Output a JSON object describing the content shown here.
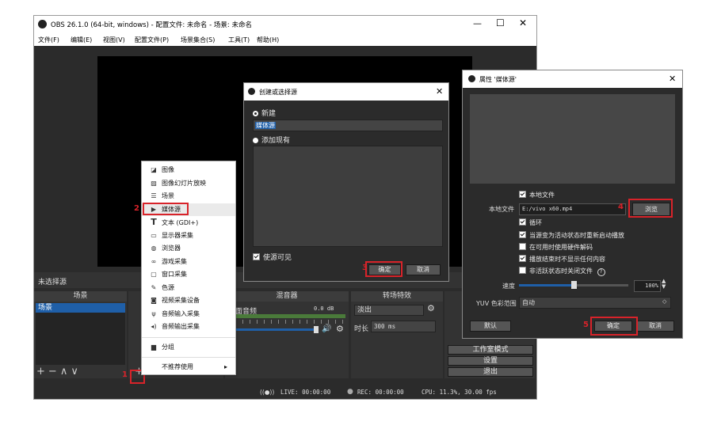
{
  "obs": {
    "title": "OBS 26.1.0 (64-bit, windows) - 配置文件: 未命名 - 场景: 未命名",
    "menu": [
      "文件(F)",
      "编辑(E)",
      "视图(V)",
      "配置文件(P)",
      "场景集合(S)",
      "工具(T)",
      "帮助(H)"
    ],
    "no_source": "未选择源",
    "scenes_header": "场景",
    "scene_item": "场景",
    "mixer_header": "混音器",
    "mixer_channel": "桌面音频",
    "mixer_db": "0.0 dB",
    "transition_header": "转场特效",
    "transition_value": "淡出",
    "duration_label": "时长",
    "duration_value": "300 ms",
    "controls": [
      "工作室模式",
      "设置",
      "退出"
    ],
    "status": {
      "live": "LIVE: 00:00:00",
      "rec": "REC: 00:00:00",
      "cpu": "CPU: 11.3%, 30.00 fps"
    }
  },
  "context_menu": {
    "items": [
      {
        "label": "图像",
        "icon": "image-icon"
      },
      {
        "label": "图像幻灯片放映",
        "icon": "slideshow-icon"
      },
      {
        "label": "场景",
        "icon": "scene-list-icon"
      },
      {
        "label": "媒体源",
        "icon": "play-icon"
      },
      {
        "label": "文本 (GDI+)",
        "icon": "text-icon"
      },
      {
        "label": "显示器采集",
        "icon": "monitor-icon"
      },
      {
        "label": "浏览器",
        "icon": "globe-icon"
      },
      {
        "label": "游戏采集",
        "icon": "gamepad-icon"
      },
      {
        "label": "窗口采集",
        "icon": "window-icon"
      },
      {
        "label": "色源",
        "icon": "brush-icon"
      },
      {
        "label": "视频采集设备",
        "icon": "camera-icon"
      },
      {
        "label": "音频输入采集",
        "icon": "microphone-icon"
      },
      {
        "label": "音频输出采集",
        "icon": "speaker-icon"
      },
      {
        "label": "分组",
        "icon": "folder-icon"
      },
      {
        "label": "不推荐使用",
        "icon": "chevron-right-icon"
      }
    ]
  },
  "create_dialog": {
    "title": "创建或选择源",
    "new_label": "新建",
    "new_name": "媒体源",
    "existing_label": "添加现有",
    "visible_label": "使源可见",
    "ok": "确定",
    "cancel": "取消"
  },
  "props_dialog": {
    "title": "属性 '媒体源'",
    "local_file_check": "本地文件",
    "local_file_label": "本地文件",
    "local_file_value": "E:/vivo x60.mp4",
    "browse": "浏览",
    "options": [
      {
        "label": "循环",
        "checked": true
      },
      {
        "label": "当源变为活动状态时重新启动播放",
        "checked": true
      },
      {
        "label": "在可用时使用硬件解码",
        "checked": false
      },
      {
        "label": "播放结束时不显示任何内容",
        "checked": true
      },
      {
        "label": "非活跃状态时关闭文件",
        "checked": false
      }
    ],
    "speed_label": "速度",
    "speed_value": "100%",
    "speed_fraction": 0.5,
    "yuv_label": "YUV 色彩范围",
    "yuv_value": "自动",
    "defaults": "默认",
    "ok": "确定",
    "cancel": "取消"
  },
  "annotations": [
    "1",
    "2",
    "3",
    "4",
    "5"
  ],
  "colors": {
    "annotation_red": "#d8232a",
    "obs_dark": "#2b2b2b",
    "selection_blue": "#1f5fa8"
  }
}
